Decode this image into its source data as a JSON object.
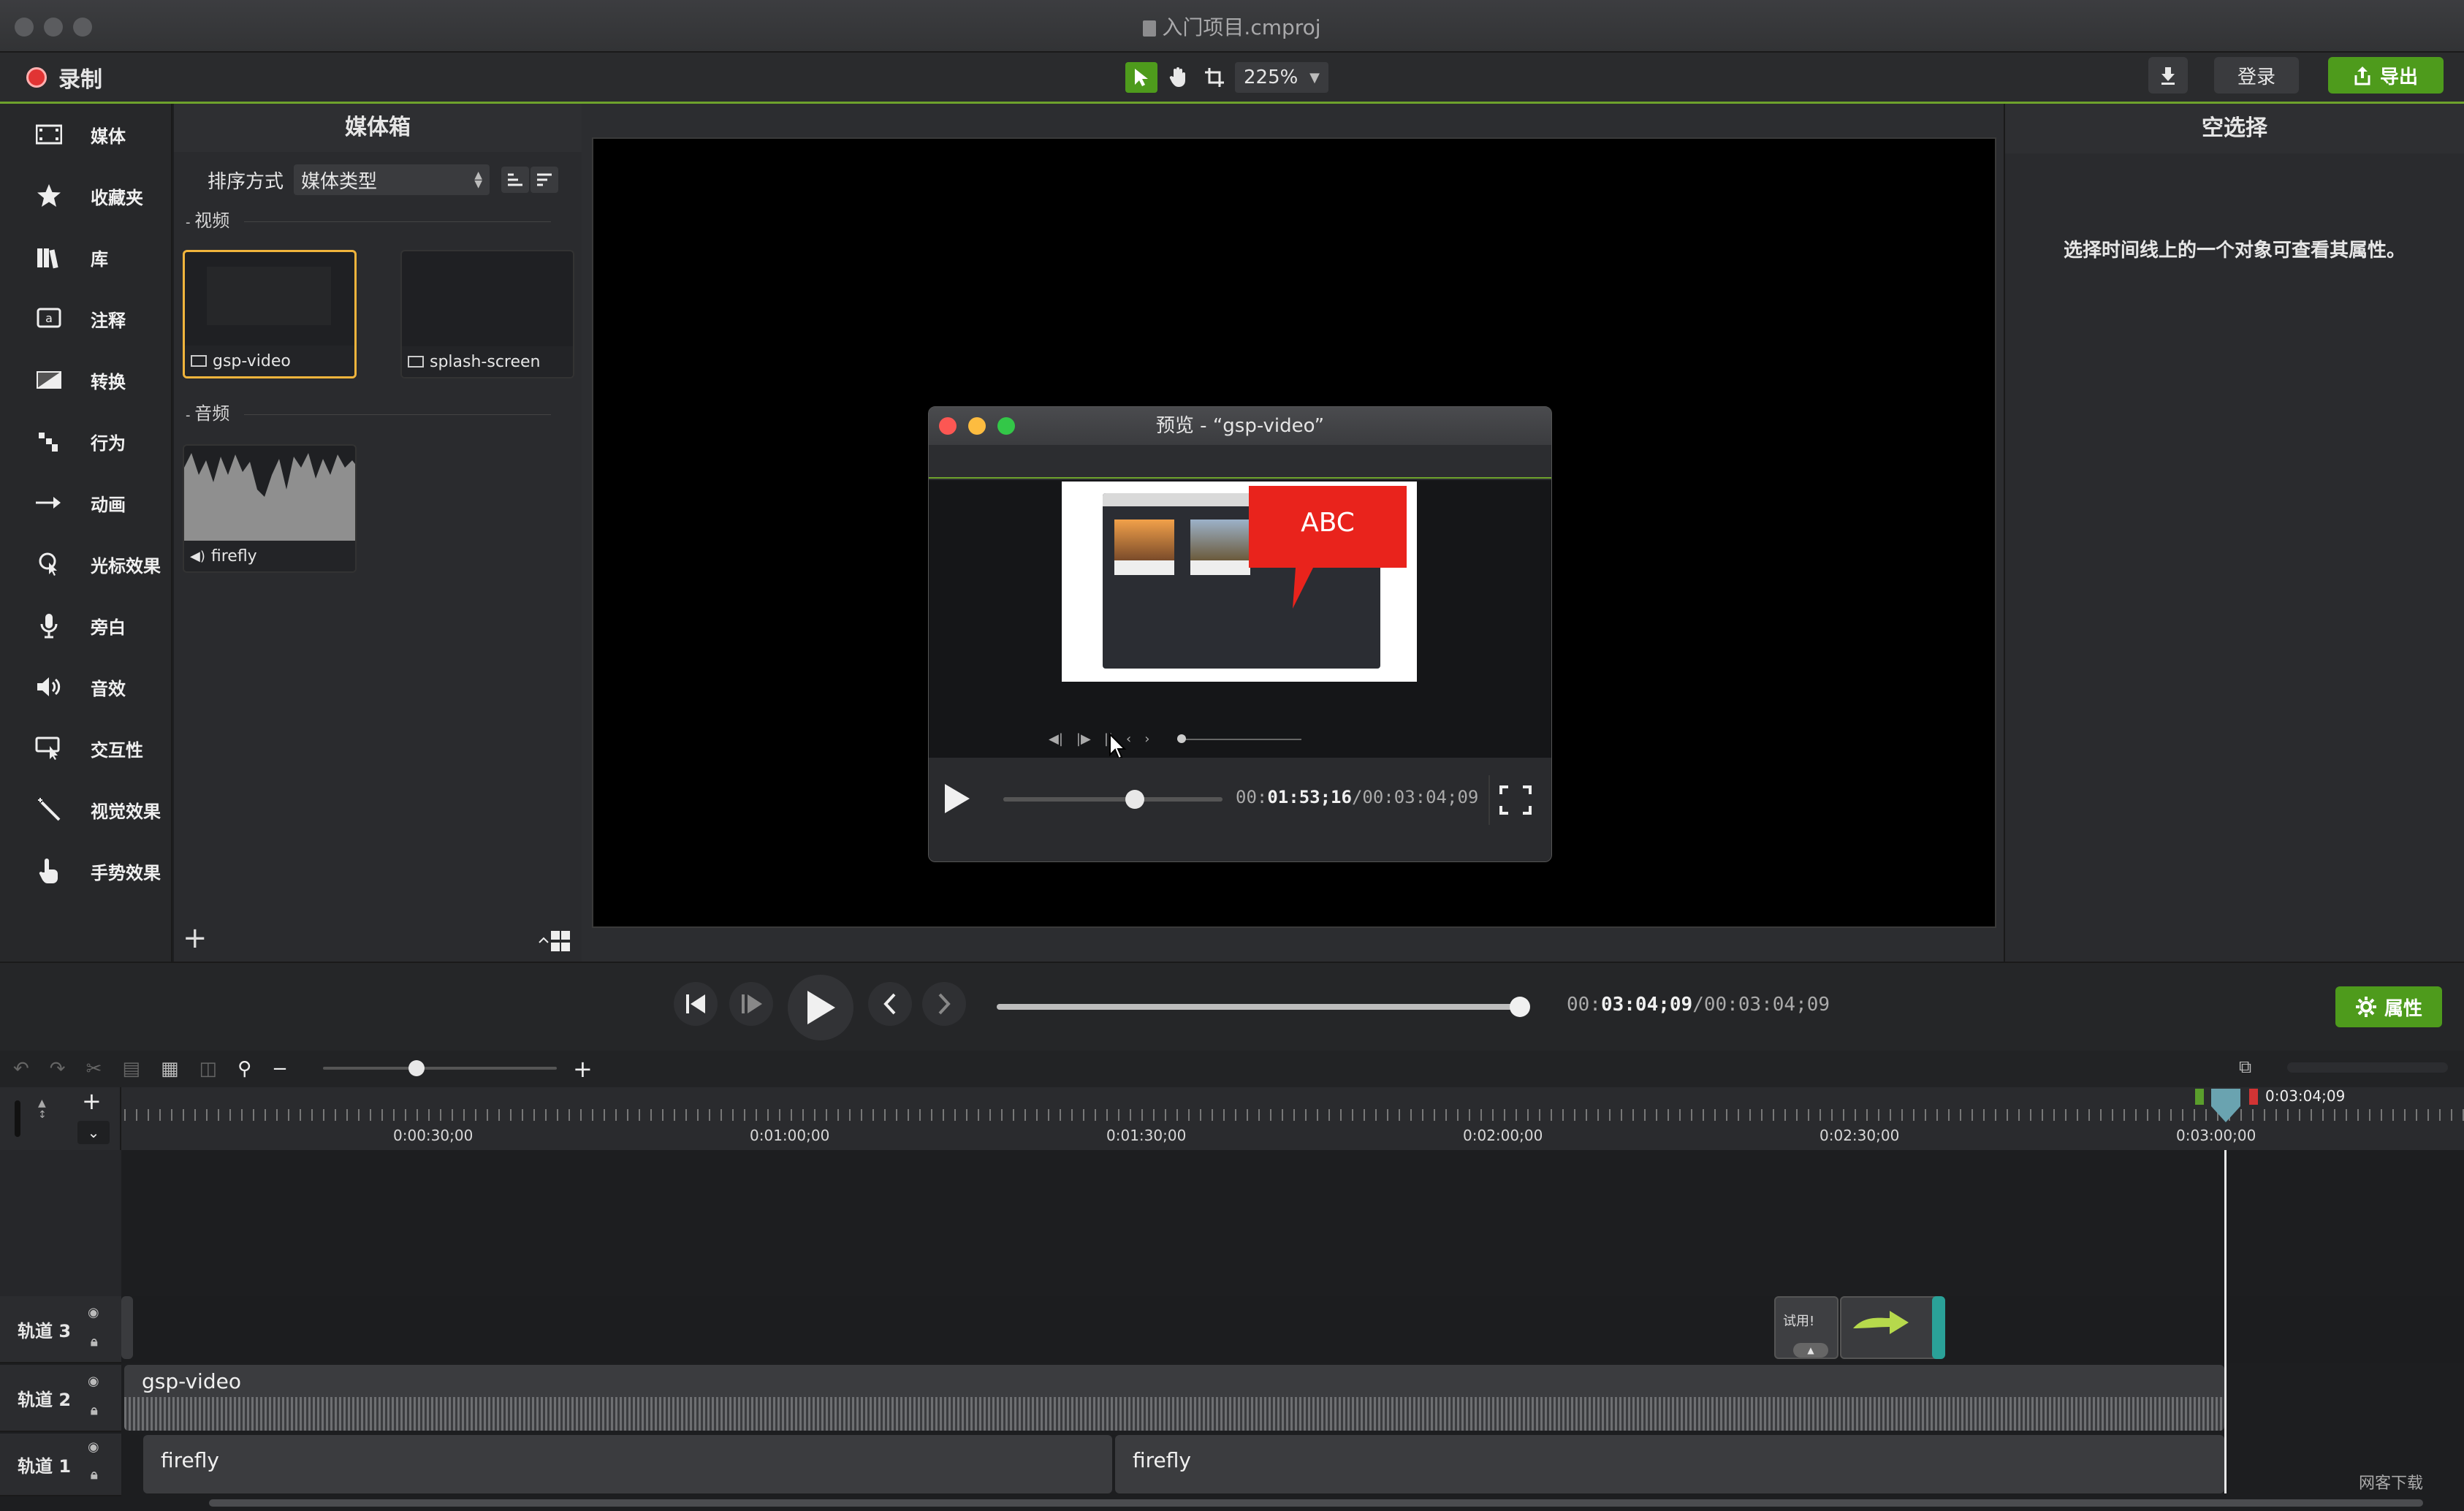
{
  "window": {
    "title": "入门项目.cmproj"
  },
  "toolbar": {
    "record_label": "录制",
    "zoom": "225%",
    "login_label": "登录",
    "export_label": "导出"
  },
  "rail": {
    "items": [
      {
        "label": "媒体",
        "icon": "film-icon"
      },
      {
        "label": "收藏夹",
        "icon": "star-icon"
      },
      {
        "label": "库",
        "icon": "library-icon"
      },
      {
        "label": "注释",
        "icon": "annotation-icon"
      },
      {
        "label": "转换",
        "icon": "transition-icon"
      },
      {
        "label": "行为",
        "icon": "behavior-icon"
      },
      {
        "label": "动画",
        "icon": "animation-icon"
      },
      {
        "label": "光标效果",
        "icon": "cursor-effect-icon"
      },
      {
        "label": "旁白",
        "icon": "microphone-icon"
      },
      {
        "label": "音效",
        "icon": "speaker-icon"
      },
      {
        "label": "交互性",
        "icon": "interactivity-icon"
      },
      {
        "label": "视觉效果",
        "icon": "magic-wand-icon"
      },
      {
        "label": "手势效果",
        "icon": "gesture-icon"
      }
    ]
  },
  "bin": {
    "title": "媒体箱",
    "sort_label": "排序方式",
    "sort_value": "媒体类型",
    "video_section": "视频",
    "audio_section": "音频",
    "video_items": [
      "gsp-video",
      "splash-screen"
    ],
    "audio_items": [
      "firefly"
    ]
  },
  "preview": {
    "title": "预览 - “gsp-video”",
    "bubble_text": "ABC",
    "time_current": "01:53;16",
    "time_prefix": "00:",
    "time_total": "/00:03:04;09",
    "progress": 0.6
  },
  "props": {
    "title": "空选择",
    "hint": "选择时间线上的一个对象可查看其属性。"
  },
  "playback": {
    "time_prefix": "00:",
    "time_current": "03:04;09",
    "time_total": "/00:03:04;09",
    "progress": 1.0,
    "properties_label": "属性"
  },
  "timeline": {
    "ruler_ticks": [
      "0:00:30;00",
      "0:01:00;00",
      "0:01:30;00",
      "0:02:00;00",
      "0:02:30;00",
      "0:03:00;00"
    ],
    "playhead_time": "0:03:04;09",
    "zoom_level": 0.4,
    "tracks": [
      {
        "label": "轨道 3"
      },
      {
        "label": "轨道 2"
      },
      {
        "label": "轨道 1"
      }
    ],
    "clips": {
      "track2": "gsp-video",
      "track1_a": "firefly",
      "track1_b": "firefly",
      "callout": "试用!"
    }
  },
  "watermark": "网客下载"
}
